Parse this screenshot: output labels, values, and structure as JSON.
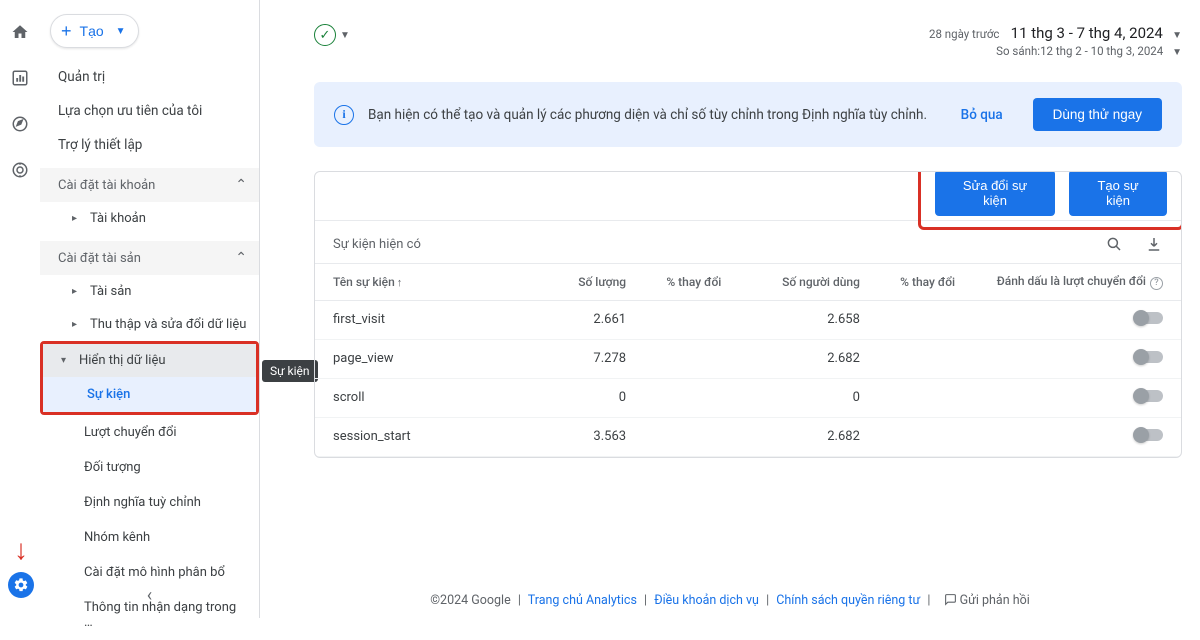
{
  "rail": {
    "tooltip": "Sự kiện"
  },
  "sidebar": {
    "create": "Tạo",
    "items": [
      "Quản trị",
      "Lựa chọn ưu tiên của tôi",
      "Trợ lý thiết lập"
    ],
    "account_settings": "Cài đặt tài khoản",
    "account": "Tài khoản",
    "property_settings": "Cài đặt tài sản",
    "property": "Tài sản",
    "data_collection": "Thu thập và sửa đổi dữ liệu",
    "data_display": "Hiển thị dữ liệu",
    "leaves": [
      "Sự kiện",
      "Lượt chuyển đổi",
      "Đối tượng",
      "Định nghĩa tuỳ chỉnh",
      "Nhóm kênh",
      "Cài đặt mô hình phân bổ",
      "Thông tin nhận dạng trong …"
    ]
  },
  "date": {
    "prefix": "28 ngày trước",
    "range": "11 thg 3 - 7 thg 4, 2024",
    "compare": "So sánh:12 thg 2 - 10 thg 3, 2024"
  },
  "banner": {
    "text": "Bạn hiện có thể tạo và quản lý các phương diện và chỉ số tùy chỉnh trong Định nghĩa tùy chỉnh.",
    "skip": "Bỏ qua",
    "cta": "Dùng thử ngay"
  },
  "buttons": {
    "edit": "Sửa đổi sự kiện",
    "create": "Tạo sự kiện"
  },
  "table": {
    "title": "Sự kiện hiện có",
    "cols": [
      "Tên sự kiện",
      "Số lượng",
      "% thay đổi",
      "Số người dùng",
      "% thay đổi",
      "Đánh dấu là lượt chuyển đổi"
    ],
    "rows": [
      {
        "name": "first_visit",
        "count": "2.661",
        "pct1": "",
        "users": "2.658",
        "pct2": ""
      },
      {
        "name": "page_view",
        "count": "7.278",
        "pct1": "",
        "users": "2.682",
        "pct2": ""
      },
      {
        "name": "scroll",
        "count": "0",
        "pct1": "",
        "users": "0",
        "pct2": ""
      },
      {
        "name": "session_start",
        "count": "3.563",
        "pct1": "",
        "users": "2.682",
        "pct2": ""
      }
    ]
  },
  "footer": {
    "copyright": "©2024 Google",
    "links": [
      "Trang chủ Analytics",
      "Điều khoản dịch vụ",
      "Chính sách quyền riêng tư"
    ],
    "feedback": "Gửi phản hồi"
  }
}
